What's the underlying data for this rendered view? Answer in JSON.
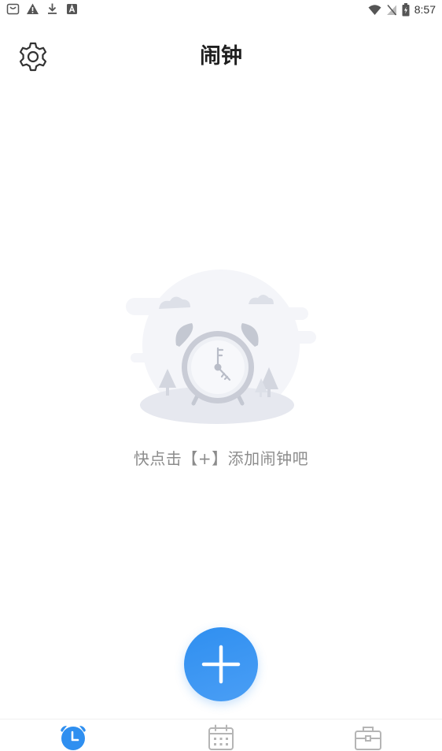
{
  "status_bar": {
    "time": "8:57",
    "left_icons": [
      "bag-notification-icon",
      "warning-icon",
      "download-icon",
      "app-a-icon"
    ],
    "right_icons": [
      "wifi-icon",
      "no-sim-icon",
      "battery-charging-icon"
    ]
  },
  "header": {
    "title": "闹钟",
    "settings_icon": "gear-icon"
  },
  "empty_state": {
    "hint": "快点击【+】添加闹钟吧",
    "illustration": "alarm-clock-illustration"
  },
  "fab": {
    "icon": "plus-icon",
    "color": "#2f8ff0"
  },
  "bottom_nav": {
    "tabs": [
      {
        "icon": "alarm-clock-icon",
        "active": true
      },
      {
        "icon": "calendar-icon",
        "active": false
      },
      {
        "icon": "toolbox-icon",
        "active": false
      }
    ],
    "active_color": "#2f8ff0",
    "inactive_color": "#b5b5b5"
  }
}
